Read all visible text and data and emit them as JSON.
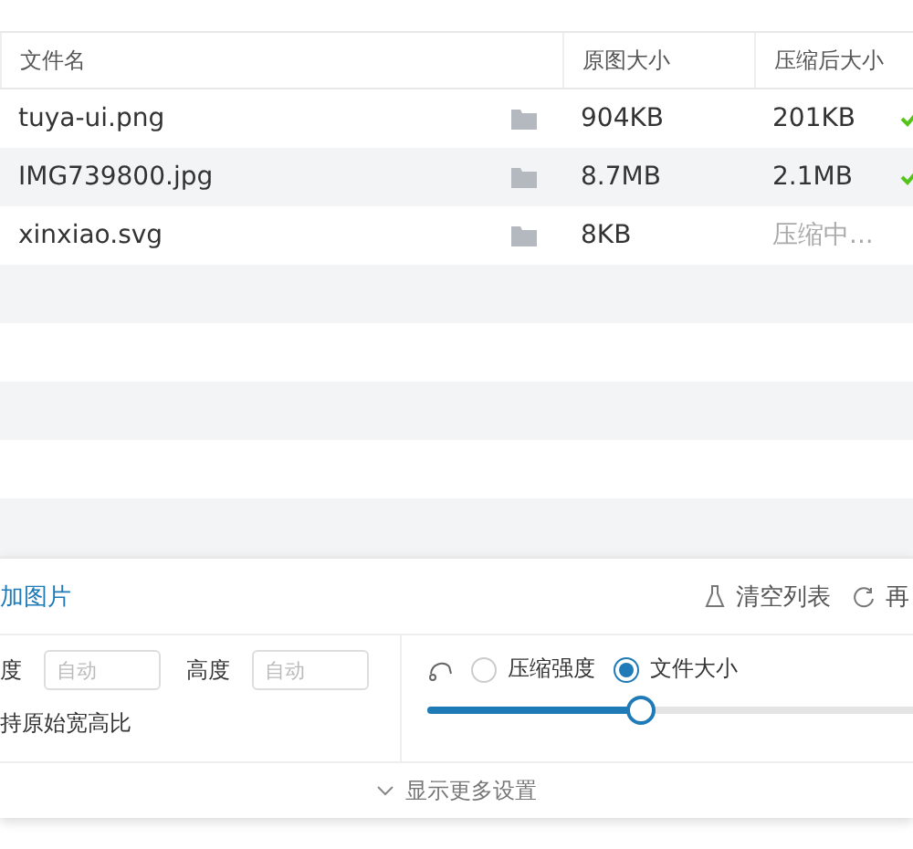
{
  "table": {
    "columns": [
      "文件名",
      "原图大小",
      "压缩后大小"
    ],
    "rows": [
      {
        "name": "tuya-ui.png",
        "original": "904KB",
        "compressed": "201KB",
        "done": true
      },
      {
        "name": "IMG739800.jpg",
        "original": "8.7MB",
        "compressed": "2.1MB",
        "done": true
      },
      {
        "name": "xinxiao.svg",
        "original": "8KB",
        "compressed": "压缩中...",
        "done": false
      }
    ]
  },
  "toolbar": {
    "add": "加图片",
    "clear": "清空列表",
    "retry": "再"
  },
  "size": {
    "width_label": "度",
    "width_placeholder": "自动",
    "height_label": "高度",
    "height_placeholder": "自动",
    "keep_ratio": "持原始宽高比"
  },
  "mode": {
    "options": [
      {
        "label": "压缩强度",
        "selected": false
      },
      {
        "label": "文件大小",
        "selected": true
      }
    ],
    "level": 0.39
  },
  "more": "显示更多设置"
}
